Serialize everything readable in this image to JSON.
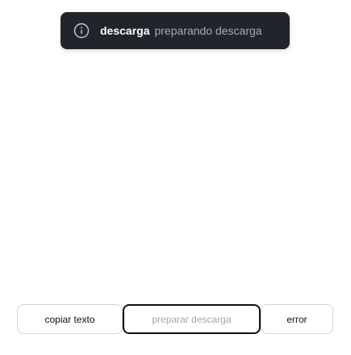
{
  "toast": {
    "icon": "info-circle-icon",
    "title": "descarga",
    "message": "preparando descarga",
    "colors": {
      "background": "#22242b",
      "title": "#ffffff",
      "message": "#a8aab2"
    }
  },
  "buttons": {
    "copy_label": "copiar texto",
    "prepare_label": "preparar descarga",
    "error_label": "error"
  }
}
